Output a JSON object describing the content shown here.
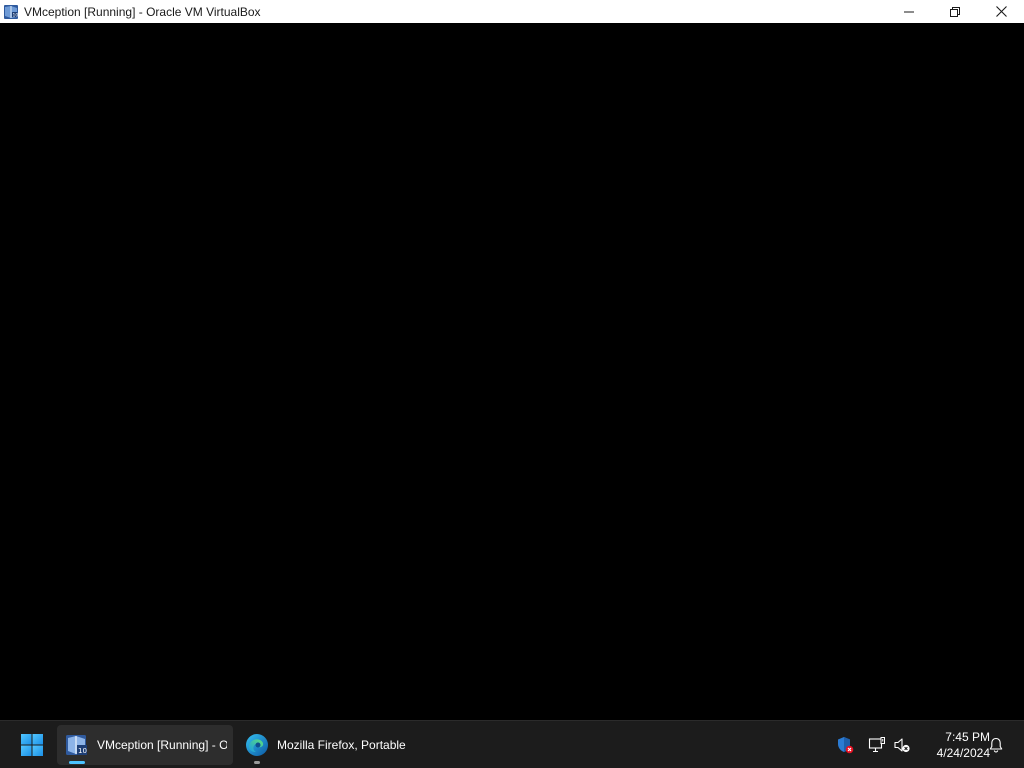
{
  "window": {
    "title": "VMception [Running] - Oracle VM VirtualBox",
    "icon": "virtualbox-icon",
    "controls": {
      "minimize_icon": "minimize-icon",
      "restore_icon": "restore-icon",
      "close_icon": "close-icon"
    }
  },
  "taskbar": {
    "start_icon": "windows-logo-icon",
    "items": [
      {
        "label": "VMception [Running] - Oracle VM VirtualBox",
        "icon": "virtualbox-icon",
        "active": true
      },
      {
        "label": "Mozilla Firefox, Portable",
        "icon": "edge-browser-icon",
        "active": false
      }
    ],
    "tray": {
      "icons": [
        "security-shield-icon",
        "network-icon",
        "volume-muted-icon"
      ],
      "time": "7:45 PM",
      "date": "4/24/2024",
      "notification_icon": "notification-bell-icon"
    }
  },
  "colors": {
    "taskbar_bg": "#1c1c1c",
    "active_indicator": "#4cc2ff",
    "vm_display": "#000000"
  }
}
